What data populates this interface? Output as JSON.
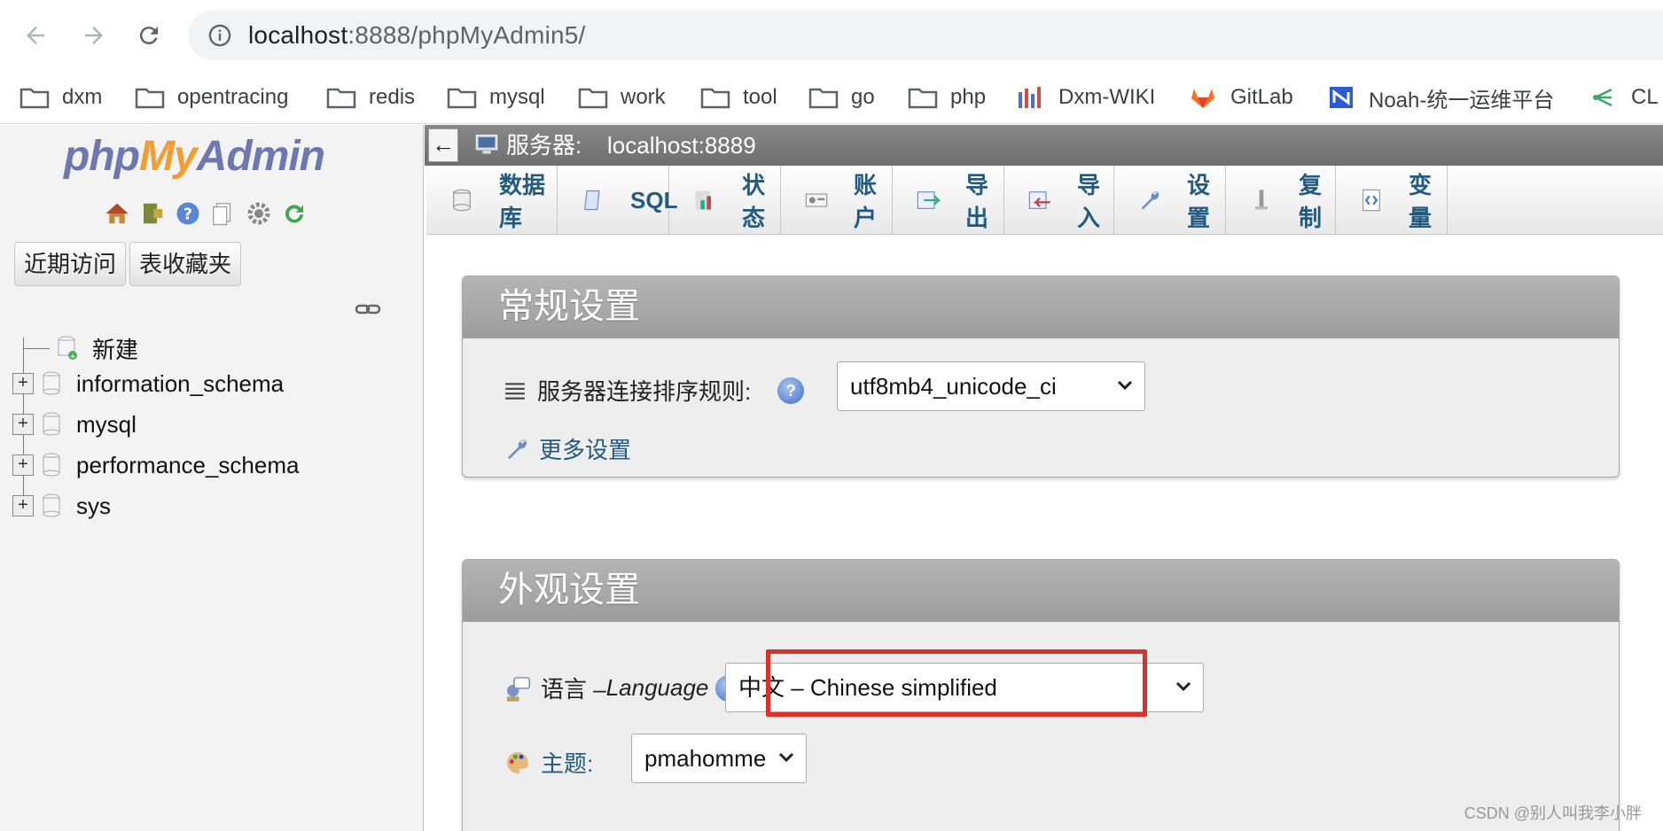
{
  "browser": {
    "url_host": "localhost",
    "url_path": ":8888/phpMyAdmin5/",
    "bookmarks": [
      {
        "label": "dxm",
        "icon": "folder-icon"
      },
      {
        "label": "opentracing",
        "icon": "folder-icon"
      },
      {
        "label": "redis",
        "icon": "folder-icon"
      },
      {
        "label": "mysql",
        "icon": "folder-icon"
      },
      {
        "label": "work",
        "icon": "folder-icon"
      },
      {
        "label": "tool",
        "icon": "folder-icon"
      },
      {
        "label": "go",
        "icon": "folder-icon"
      },
      {
        "label": "php",
        "icon": "folder-icon"
      },
      {
        "label": "Dxm-WIKI",
        "icon": "wiki-icon"
      },
      {
        "label": "GitLab",
        "icon": "gitlab-icon"
      },
      {
        "label": "Noah-统一运维平台",
        "icon": "noah-icon"
      },
      {
        "label": "CL",
        "icon": "cl-icon"
      }
    ]
  },
  "nav": {
    "logo": {
      "php": "php",
      "my": "My",
      "admin": "Admin"
    },
    "tabs": [
      "近期访问",
      "表收藏夹"
    ],
    "tree": {
      "new_label": "新建",
      "databases": [
        "information_schema",
        "mysql",
        "performance_schema",
        "sys"
      ]
    }
  },
  "main": {
    "server_label": "服务器:",
    "server_host": "localhost:8889",
    "back_arrow": "←",
    "tabs": [
      {
        "label": "数据库",
        "icon": "database-icon"
      },
      {
        "label": "SQL",
        "icon": "sql-icon"
      },
      {
        "label": "状态",
        "icon": "status-icon"
      },
      {
        "label": "账户",
        "icon": "accounts-icon"
      },
      {
        "label": "导出",
        "icon": "export-icon"
      },
      {
        "label": "导入",
        "icon": "import-icon"
      },
      {
        "label": "设置",
        "icon": "settings-icon"
      },
      {
        "label": "复制",
        "icon": "replication-icon"
      },
      {
        "label": "变量",
        "icon": "variables-icon"
      }
    ],
    "general": {
      "title": "常规设置",
      "collation_label": "服务器连接排序规则:",
      "collation_value": "utf8mb4_unicode_ci",
      "more_settings": "更多设置"
    },
    "appearance": {
      "title": "外观设置",
      "language_label": "语言 – ",
      "language_label_en": "Language",
      "language_value": "中文 – Chinese simplified",
      "theme_label": "主题:",
      "theme_value": "pmahomme"
    }
  },
  "watermark": "CSDN @别人叫我李小胖",
  "colors": {
    "highlight": "#d93228",
    "link": "#235a81"
  }
}
